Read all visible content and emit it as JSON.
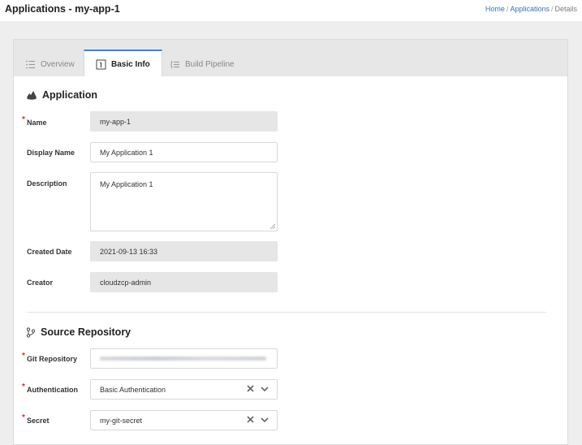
{
  "header": {
    "title": "Applications - my-app-1",
    "breadcrumb": [
      "Home",
      "Applications",
      "Details"
    ],
    "breadcrumb_sep": "/"
  },
  "tabs": [
    {
      "label": "Overview",
      "icon": "list-icon",
      "active": false
    },
    {
      "label": "Basic Info",
      "icon": "info-box-icon",
      "active": true
    },
    {
      "label": "Build Pipeline",
      "icon": "pipeline-icon",
      "active": false
    }
  ],
  "application": {
    "title": "Application",
    "icon": "application-icon",
    "fields": {
      "name": {
        "label": "Name",
        "value": "my-app-1",
        "required": true
      },
      "display_name": {
        "label": "Display Name",
        "value": "My Application 1"
      },
      "description": {
        "label": "Description",
        "value": "My Application 1"
      },
      "created_date": {
        "label": "Created Date",
        "value": "2021-09-13 16:33"
      },
      "creator": {
        "label": "Creator",
        "value": "cloudzcp-admin"
      }
    }
  },
  "source_repository": {
    "title": "Source Repository",
    "icon": "git-branch-icon",
    "fields": {
      "git_repository": {
        "label": "Git Repository",
        "required": true
      },
      "authentication": {
        "label": "Authentication",
        "value": "Basic Authentication",
        "required": true
      },
      "secret": {
        "label": "Secret",
        "value": "my-git-secret",
        "required": true
      }
    }
  },
  "colors": {
    "accent": "#3b86d6",
    "required": "#d0312d",
    "link": "#3b6fb6"
  }
}
